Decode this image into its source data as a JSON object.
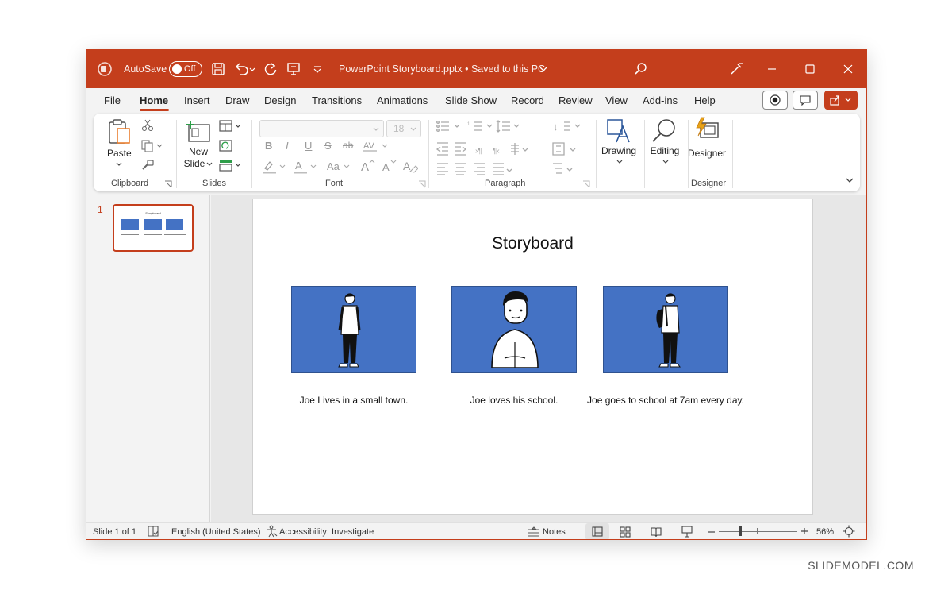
{
  "titlebar": {
    "autosave_label": "AutoSave",
    "autosave_state": "Off",
    "document_title": "PowerPoint Storyboard.pptx • Saved to this PC",
    "accent_color": "#c43e1c"
  },
  "tabs": [
    "File",
    "Home",
    "Insert",
    "Draw",
    "Design",
    "Transitions",
    "Animations",
    "Slide Show",
    "Record",
    "Review",
    "View",
    "Add-ins",
    "Help"
  ],
  "ribbon": {
    "clipboard": {
      "paste": "Paste",
      "label": "Clipboard"
    },
    "slides": {
      "new": "New",
      "slide": "Slide",
      "label": "Slides"
    },
    "font": {
      "size": "18",
      "label": "Font"
    },
    "paragraph": {
      "label": "Paragraph"
    },
    "drawing": {
      "label": "Drawing"
    },
    "editing": {
      "label": "Editing"
    },
    "designer": {
      "button": "Designer",
      "label": "Designer"
    }
  },
  "thumbnail": {
    "number": "1",
    "title": "Storyboard"
  },
  "slide": {
    "title": "Storyboard",
    "captions": [
      "Joe Lives in a small town.",
      "Joe loves his school.",
      "Joe goes to school at 7am every day."
    ],
    "panel_color": "#4472c4"
  },
  "statusbar": {
    "slide_info": "Slide 1 of 1",
    "language": "English (United States)",
    "accessibility": "Accessibility: Investigate",
    "notes": "Notes",
    "zoom": "56%",
    "zoom_fraction": 0.56
  },
  "watermark": "SLIDEMODEL.COM"
}
